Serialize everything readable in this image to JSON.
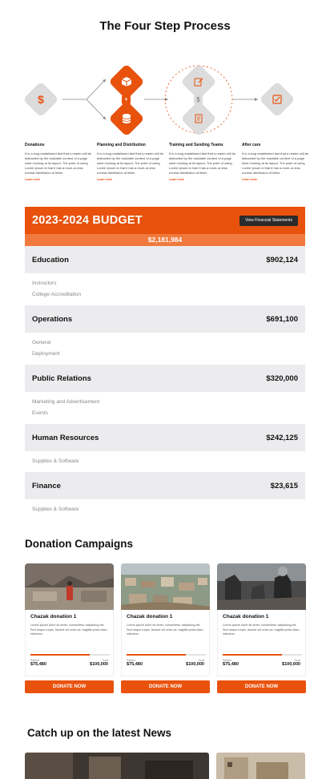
{
  "page_title": "The Four Step Process",
  "process": {
    "steps": [
      {
        "title": "Donations",
        "text": "It is a long established fact that a reader will be distracted by the readable content of a page when looking at its layout. The point of using Lorem Ipsum is that it has a more-or-less normal distribution of letter.",
        "link": "Learn more",
        "icons": [
          "dollar-icon"
        ]
      },
      {
        "title": "Planning and Distribution",
        "text": "It is a long established fact that a reader will be distracted by the readable content of a page when looking at its layout. The point of using Lorem Ipsum is that it has a more-or-less normal distribution of letter.",
        "link": "Learn more",
        "icons": [
          "package-icon",
          "database-icon"
        ]
      },
      {
        "title": "Training and Sending Teams",
        "text": "It is a long established fact that a reader will be distracted by the readable content of a page when looking at its layout. The point of using Lorem Ipsum is that it has a more-or-less normal distribution of letter.",
        "link": "Learn more",
        "icons": [
          "edit-icon",
          "document-icon"
        ]
      },
      {
        "title": "After care",
        "text": "It is a long established fact that a reader will be distracted by the readable content of a page when looking at its layout. The point of using Lorem Ipsum is that it has a more-or-less normal distribution of letter.",
        "link": "Learn more",
        "icons": [
          "checkbox-icon"
        ]
      }
    ],
    "glyphs": {
      "dollar": "$",
      "plus": "+"
    }
  },
  "budget": {
    "title": "2023-2024 BUDGET",
    "button_label": "View Financial Statements",
    "total": "$2,181,984",
    "categories": [
      {
        "name": "Education",
        "amount": "$902,124",
        "subs": [
          "Instructors",
          "College Accreditation"
        ]
      },
      {
        "name": "Operations",
        "amount": "$691,100",
        "subs": [
          "General",
          "Deployment"
        ]
      },
      {
        "name": "Public Relations",
        "amount": "$320,000",
        "subs": [
          "Marketing and Advertisement",
          "Events"
        ]
      },
      {
        "name": "Human Resources",
        "amount": "$242,125",
        "subs": [
          "Supplies & Software"
        ]
      },
      {
        "name": "Finance",
        "amount": "$23,615",
        "subs": [
          "Supplies & Software"
        ]
      }
    ]
  },
  "campaigns": {
    "title": "Donation Campaigns",
    "items": [
      {
        "title": "Chazak donation 1",
        "text": "Lorem ipsum dolor sit amet, consectetur adipiscing elit. Sed neque turpis, laoreet vel enim ac, sagittis porta diam interdum.",
        "raised_label": "Raised",
        "raised": "$75,480",
        "goal_label": "Goal",
        "goal": "$100,000",
        "progress": 0.75,
        "button": "DONATE NOW"
      },
      {
        "title": "Chazak donation 1",
        "text": "Lorem ipsum dolor sit amet, consectetur adipiscing elit. Sed neque turpis, laoreet vel enim ac, sagittis porta diam interdum.",
        "raised_label": "Raised",
        "raised": "$75,480",
        "goal_label": "Goal",
        "goal": "$100,000",
        "progress": 0.75,
        "button": "DONATE NOW"
      },
      {
        "title": "Chazak donation 1",
        "text": "Lorem ipsum dolor sit amet, consectetur adipiscing elit. Sed neque turpis, laoreet vel enim ac, sagittis porta diam interdum.",
        "raised_label": "Raised",
        "raised": "$75,480",
        "goal_label": "Goal",
        "goal": "$100,000",
        "progress": 0.75,
        "button": "DONATE NOW"
      }
    ]
  },
  "news": {
    "title": "Catch up on the latest News"
  },
  "colors": {
    "accent": "#e8520d",
    "accent_light": "#f07a3e",
    "dark_button": "#2b2b2b",
    "row_bg": "#ececef"
  }
}
